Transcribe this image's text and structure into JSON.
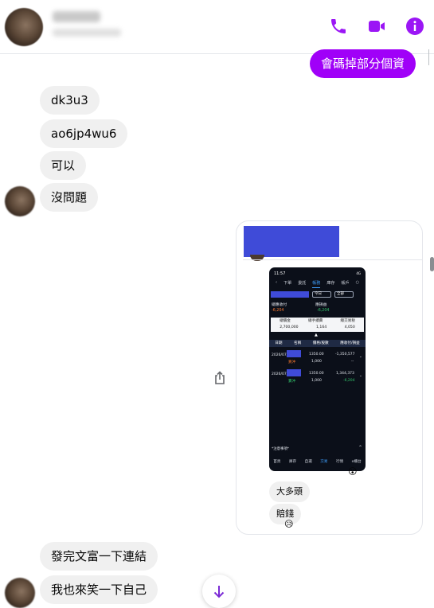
{
  "header": {
    "contact_name": "",
    "contact_status": "",
    "icons": {
      "call": "phone-icon",
      "video": "video-icon",
      "info": "info-icon"
    },
    "accent_color": "#a000f8"
  },
  "messages": {
    "outgoing_1": "會碼掉部分個資",
    "incoming": [
      "dk3u3",
      "ao6jp4wu6",
      "可以",
      "沒問題"
    ],
    "shared_post": {
      "phone": {
        "time": "11:57",
        "signal": "4G",
        "tabs": [
          "下單",
          "委託",
          "帳戶",
          "庫存",
          "帳務"
        ],
        "active_tab": "帳務",
        "filters": [
          "今日",
          "全部"
        ],
        "summary_labels": [
          "總應收付",
          "應損益"
        ],
        "summary_values": [
          "-6,204",
          "-6,204"
        ],
        "table_headers": [
          "總價金",
          "總手續費",
          "總交易稅"
        ],
        "table_values": [
          "2,700,000",
          "1,164",
          "4,050"
        ],
        "list_headers": [
          "日期",
          "名稱",
          "價格/股數",
          "應收付/損益"
        ],
        "rows": [
          {
            "date": "2026/07/31",
            "side": "買沖",
            "price": "1350.00",
            "qty": "1,000",
            "amount": "-1,350,577",
            "pl": "--"
          },
          {
            "date": "2026/07/31",
            "side": "賣沖",
            "price": "1350.00",
            "qty": "1,000",
            "amount": "1,344,373",
            "pl": "-6,204"
          }
        ],
        "note": "*注意事項*",
        "nav": [
          "首頁",
          "庫存",
          "自選",
          "交易",
          "行情",
          "e櫃台"
        ],
        "active_nav": "交易"
      },
      "reaction_1": "😮",
      "replies": [
        "大多頭",
        "賠錢"
      ],
      "reaction_2": "😥"
    },
    "incoming_2": [
      "發完文富一下連結",
      "我也來笑一下自己"
    ]
  },
  "controls": {
    "scroll_down": "arrow-down-icon",
    "share": "share-icon"
  }
}
